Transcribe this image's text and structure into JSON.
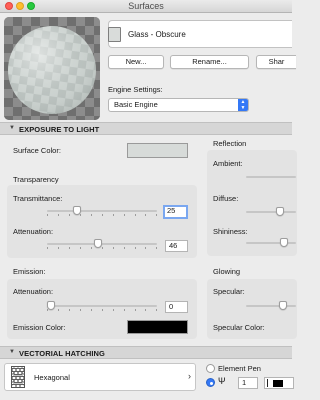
{
  "window": {
    "title": "Surfaces"
  },
  "material": {
    "name": "Glass - Obscure"
  },
  "buttons": {
    "new": "New...",
    "rename": "Rename...",
    "share": "Shar"
  },
  "engine": {
    "label": "Engine Settings:",
    "selected": "Basic Engine"
  },
  "exposure": {
    "header": "EXPOSURE TO LIGHT",
    "surface_color_label": "Surface Color:",
    "surface_color": "#d7dbd9",
    "transparency": {
      "title": "Transparency",
      "transmittance_label": "Transmittance:",
      "transmittance_value": "25",
      "transmittance_level": 0.25,
      "attenuation_label": "Attenuation:",
      "attenuation_value": "46",
      "attenuation_level": 0.46
    },
    "emission": {
      "title": "Emission:",
      "attenuation_label": "Attenuation:",
      "attenuation_value": "0",
      "attenuation_level": 0.0,
      "color_label": "Emission Color:",
      "color": "#000000"
    },
    "reflection": {
      "title": "Reflection",
      "ambient_label": "Ambient:",
      "diffuse_label": "Diffuse:",
      "shininess_label": "Shininess:"
    },
    "glowing": {
      "title": "Glowing",
      "specular_label": "Specular:",
      "specular_color_label": "Specular Color:"
    }
  },
  "hatching": {
    "header": "VECTORIAL HATCHING",
    "pattern": "Hexagonal",
    "element_pen_label": "Element Pen",
    "pen_value": "1",
    "accent": "#3478f6"
  }
}
